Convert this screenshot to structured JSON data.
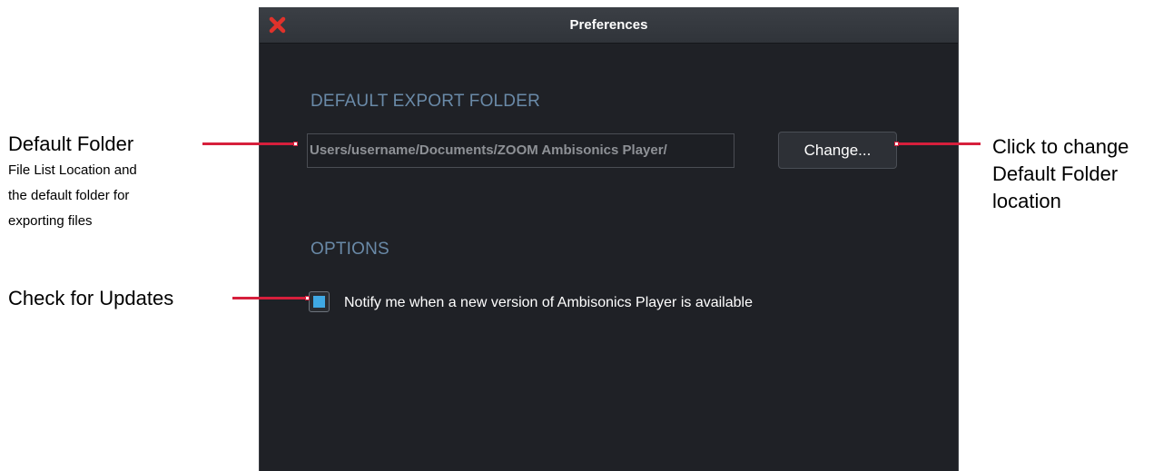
{
  "window": {
    "title": "Preferences"
  },
  "export_folder": {
    "heading": "DEFAULT EXPORT FOLDER",
    "path_value": "Users/username/Documents/ZOOM Ambisonics Player/",
    "change_label": "Change..."
  },
  "options": {
    "heading": "OPTIONS",
    "notify_checked": true,
    "notify_label": "Notify me when a new version of Ambisonics Player is available"
  },
  "annotations": {
    "default_folder_title": "Default Folder",
    "default_folder_desc": [
      "File List Location and",
      "the default folder for",
      "exporting files"
    ],
    "change_callout": [
      "Click to change",
      "Default Folder",
      "location"
    ],
    "updates_title": "Check for Updates"
  },
  "colors": {
    "close_icon": "#e0322b",
    "leader_line": "#d61f3c",
    "section_heading": "#6a8aa8",
    "checkbox_fill": "#3fa9e4",
    "window_bg": "#1f2126"
  },
  "icons": {
    "close": "close-x-icon"
  }
}
